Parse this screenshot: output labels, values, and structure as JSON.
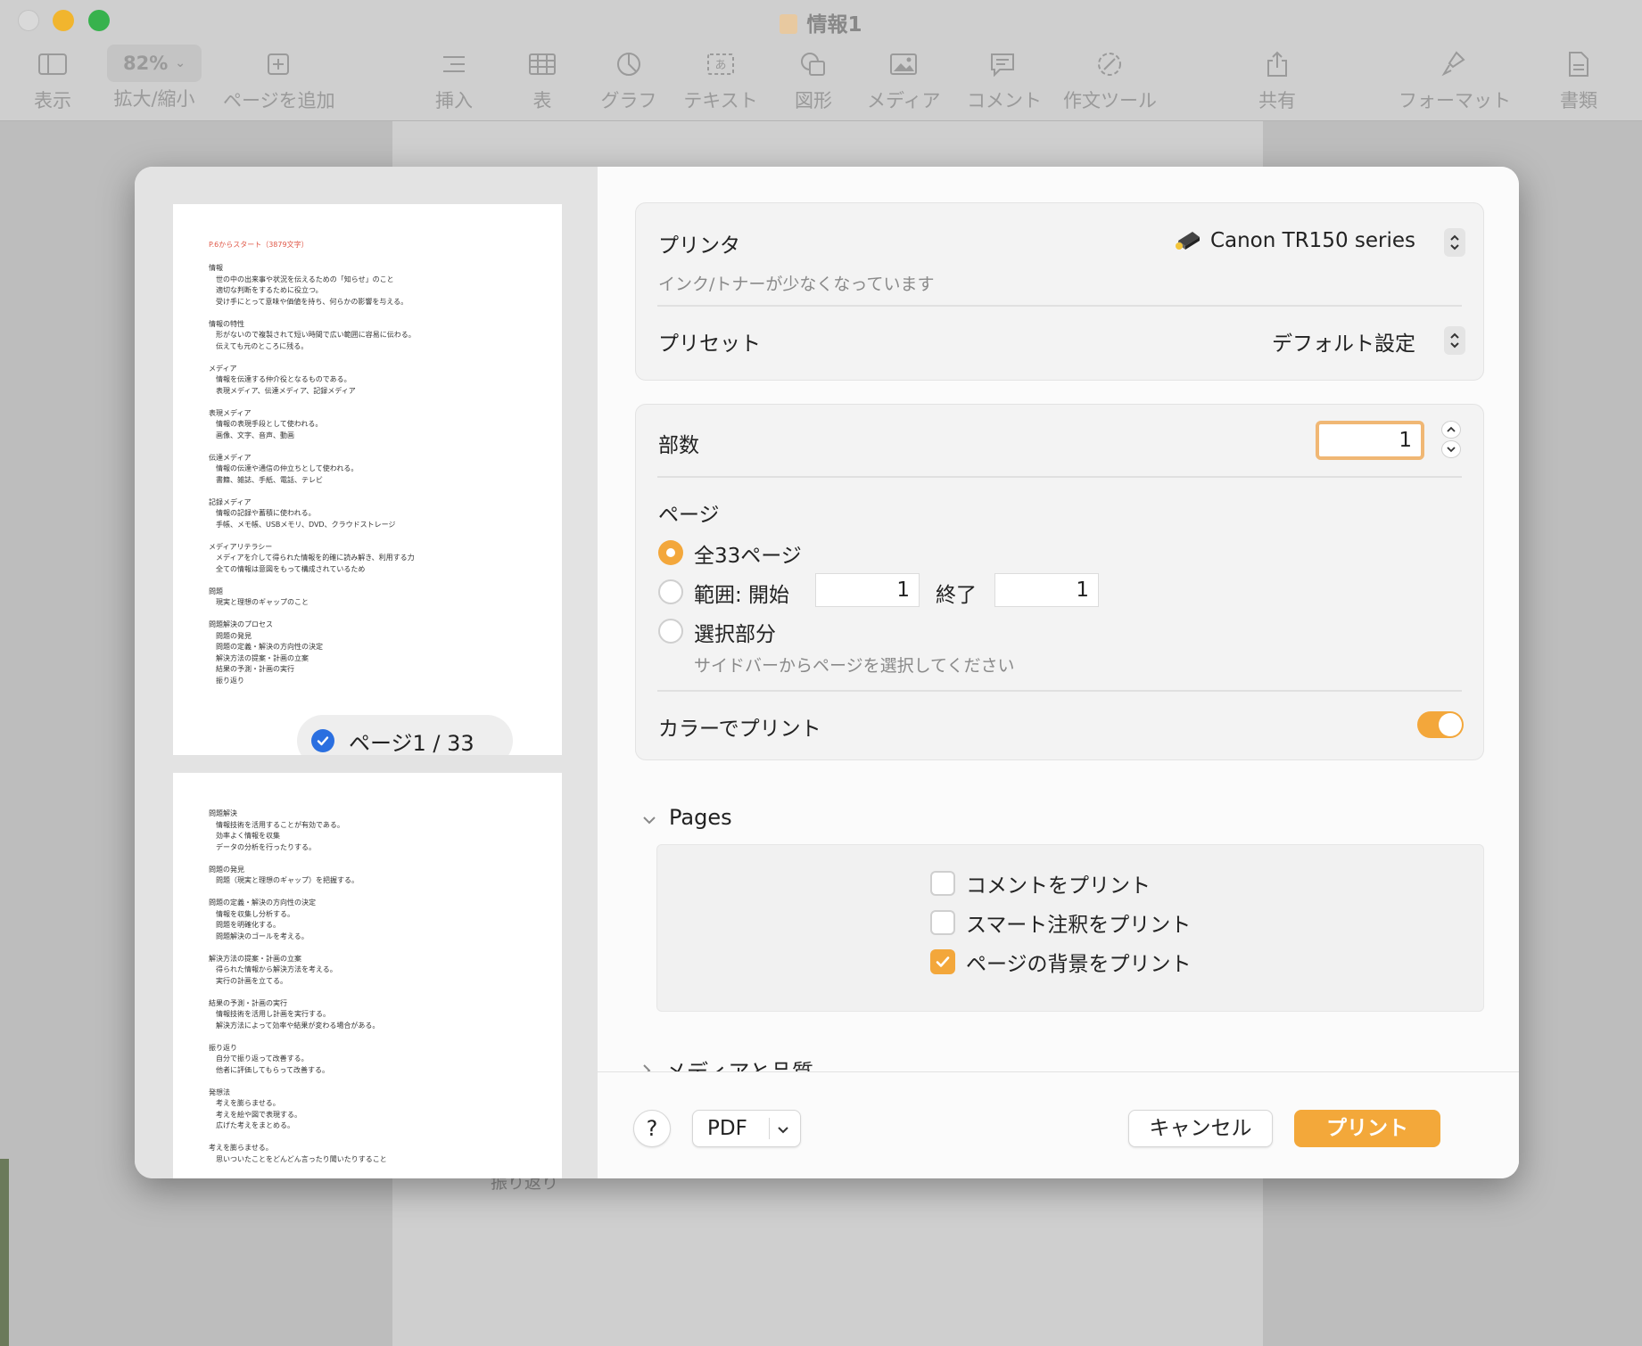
{
  "window": {
    "title": "情報1",
    "toolbar": {
      "view": "表示",
      "zoom_value": "82%",
      "zoom": "拡大/縮小",
      "add_page": "ページを追加",
      "insert": "挿入",
      "table": "表",
      "chart": "グラフ",
      "text": "テキスト",
      "shape": "図形",
      "media": "メディア",
      "comment": "コメント",
      "writing_tools": "作文ツール",
      "share": "共有",
      "format": "フォーマット",
      "document": "書類"
    },
    "background_doc_text": "振り返り"
  },
  "dialog": {
    "preview": {
      "page1_heading": "P.6からスタート（3879文字）",
      "page1_text": "情報\n　世の中の出来事や状況を伝えるための「知らせ」のこと\n　適切な判断をするために役立つ。\n　受け手にとって意味や価値を持ち、何らかの影響を与える。\n\n情報の特性\n　形がないので複製されて短い時間で広い範囲に容易に伝わる。\n　伝えても元のところに残る。\n\nメディア\n　情報を伝達する仲介役となるものである。\n　表現メディア、伝達メディア、記録メディア\n\n表現メディア\n　情報の表現手段として使われる。\n　画像、文字、音声、動画\n\n伝達メディア\n　情報の伝達や通信の仲立ちとして使われる。\n　書籍、雑誌、手紙、電話、テレビ\n\n記録メディア\n　情報の記録や蓄積に使われる。\n　手帳、メモ帳、USBメモリ、DVD、クラウドストレージ\n\nメディアリテラシー\n　メディアを介して得られた情報を的確に読み解き、利用する力\n　全ての情報は意図をもって構成されているため\n\n問題\n　現実と理想のギャップのこと\n\n問題解決のプロセス\n　問題の発見\n　問題の定義・解決の方向性の決定\n　解決方法の提案・計画の立案\n　結果の予測・計画の実行\n　振り返り",
      "page2_text": "問題解決\n　情報技術を活用することが有効である。\n　効率よく情報を収集\n　データの分析を行ったりする。\n\n問題の発見\n　問題（現実と理想のギャップ）を把握する。\n\n問題の定義・解決の方向性の決定\n　情報を収集し分析する。\n　問題を明確化する。\n　問題解決のゴールを考える。\n\n解決方法の提案・計画の立案\n　得られた情報から解決方法を考える。\n　実行の計画を立てる。\n\n結果の予測・計画の実行\n　情報技術を活用し計画を実行する。\n　解決方法によって効率や結果が変わる場合がある。\n\n振り返り\n　自分で振り返って改善する。\n　他者に評価してもらって改善する。\n\n発想法\n　考えを膨らませる。\n　考えを絵や図で表現する。\n　広げた考えをまとめる。\n\n考えを膨らませる。\n　思いついたことをどんどん言ったり聞いたりすること",
      "page_badge": "ページ1 / 33"
    },
    "printer": {
      "label": "プリンタ",
      "value": "Canon TR150 series",
      "status": "インク/トナーが少なくなっています"
    },
    "preset": {
      "label": "プリセット",
      "value": "デフォルト設定"
    },
    "copies": {
      "label": "部数",
      "value": "1"
    },
    "pages": {
      "label": "ページ",
      "all_label": "全33ページ",
      "range_label": "範囲: 開始",
      "range_from": "1",
      "range_to_label": "終了",
      "range_to": "1",
      "selection_label": "選択部分",
      "selection_hint": "サイドバーからページを選択してください",
      "selected": "all"
    },
    "color_print": {
      "label": "カラーでプリント",
      "enabled": true
    },
    "pages_section": {
      "title": "Pages",
      "print_comments": "コメントをプリント",
      "print_smart_annotations": "スマート注釈をプリント",
      "print_background": "ページの背景をプリント",
      "comments_checked": false,
      "smart_annotations_checked": false,
      "background_checked": true
    },
    "media_quality": {
      "title": "メディアと品質"
    },
    "footer": {
      "help": "?",
      "pdf": "PDF",
      "cancel": "キャンセル",
      "print": "プリント"
    }
  },
  "colors": {
    "accent": "#f3a73b",
    "badge_check": "#2a6fe0",
    "thumb_heading": "#e05a4a"
  }
}
